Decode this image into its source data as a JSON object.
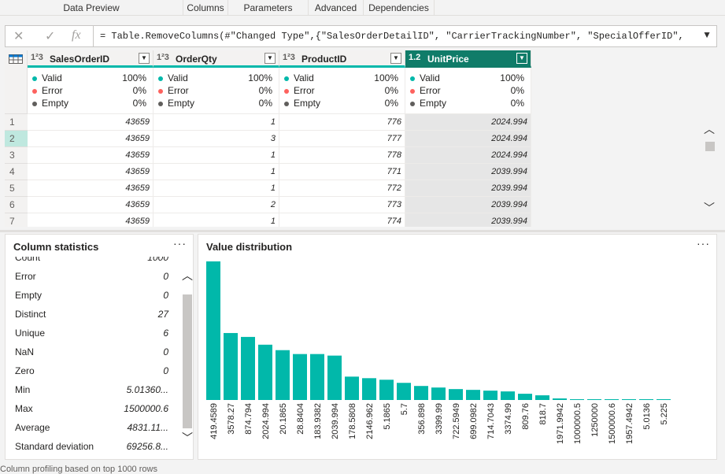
{
  "ribbon": {
    "groups": [
      "Data Preview",
      "Columns",
      "Parameters",
      "Advanced",
      "Dependencies"
    ]
  },
  "formula_bar": {
    "cancel_icon": "close-icon",
    "confirm_icon": "check-icon",
    "fx_label": "fx",
    "text": "= Table.RemoveColumns(#\"Changed Type\",{\"SalesOrderDetailID\", \"CarrierTrackingNumber\", \"SpecialOfferID\",",
    "expand_icon": "chevron-down-icon"
  },
  "grid": {
    "columns": [
      {
        "type_label": "1²3",
        "name": "SalesOrderID",
        "selected": false
      },
      {
        "type_label": "1²3",
        "name": "OrderQty",
        "selected": false
      },
      {
        "type_label": "1²3",
        "name": "ProductID",
        "selected": false
      },
      {
        "type_label": "1.2",
        "name": "UnitPrice",
        "selected": true
      }
    ],
    "quality": [
      {
        "valid": "100%",
        "error": "0%",
        "empty": "0%"
      },
      {
        "valid": "100%",
        "error": "0%",
        "empty": "0%"
      },
      {
        "valid": "100%",
        "error": "0%",
        "empty": "0%"
      },
      {
        "valid": "100%",
        "error": "0%",
        "empty": "0%"
      }
    ],
    "quality_labels": {
      "valid": "Valid",
      "error": "Error",
      "empty": "Empty"
    },
    "colors": {
      "valid": "#01b8aa",
      "error": "#fd625e",
      "empty": "#605e5c",
      "selected_header": "#107c69"
    },
    "rows": [
      {
        "n": "1",
        "cells": [
          "43659",
          "1",
          "776",
          "2024.994"
        ]
      },
      {
        "n": "2",
        "cells": [
          "43659",
          "3",
          "777",
          "2024.994"
        ]
      },
      {
        "n": "3",
        "cells": [
          "43659",
          "1",
          "778",
          "2024.994"
        ]
      },
      {
        "n": "4",
        "cells": [
          "43659",
          "1",
          "771",
          "2039.994"
        ]
      },
      {
        "n": "5",
        "cells": [
          "43659",
          "1",
          "772",
          "2039.994"
        ]
      },
      {
        "n": "6",
        "cells": [
          "43659",
          "2",
          "773",
          "2039.994"
        ]
      },
      {
        "n": "7",
        "cells": [
          "43659",
          "1",
          "774",
          "2039.994"
        ]
      }
    ]
  },
  "column_statistics": {
    "title": "Column statistics",
    "more": "···",
    "items": [
      {
        "label": "Count",
        "value": "1000"
      },
      {
        "label": "Error",
        "value": "0"
      },
      {
        "label": "Empty",
        "value": "0"
      },
      {
        "label": "Distinct",
        "value": "27"
      },
      {
        "label": "Unique",
        "value": "6"
      },
      {
        "label": "NaN",
        "value": "0"
      },
      {
        "label": "Zero",
        "value": "0"
      },
      {
        "label": "Min",
        "value": "5.01360..."
      },
      {
        "label": "Max",
        "value": "1500000.6"
      },
      {
        "label": "Average",
        "value": "4831.11..."
      },
      {
        "label": "Standard deviation",
        "value": "69256.8..."
      }
    ]
  },
  "value_distribution": {
    "title": "Value distribution",
    "more": "···"
  },
  "chart_data": {
    "type": "bar",
    "color": "#01b8aa",
    "categories": [
      "419.4589",
      "3578.27",
      "874.794",
      "2024.994",
      "20.1865",
      "28.8404",
      "183.9382",
      "2039.994",
      "178.5808",
      "2146.962",
      "5.1865",
      "5.7",
      "356.898",
      "3399.99",
      "722.5949",
      "699.0982",
      "714.7043",
      "3374.99",
      "809.76",
      "818.7",
      "1971.9942",
      "1000000.5",
      "1250000",
      "1500000.6",
      "1957.4942",
      "5.0136",
      "5.225"
    ],
    "values": [
      178,
      86,
      81,
      71,
      64,
      59,
      59,
      57,
      30,
      28,
      26,
      22,
      18,
      16,
      14,
      13,
      12,
      11,
      8,
      6,
      2,
      1,
      1,
      1,
      1,
      1,
      1
    ],
    "ylim": [
      0,
      180
    ]
  },
  "footer": {
    "text": "Column profiling based on top 1000 rows"
  }
}
